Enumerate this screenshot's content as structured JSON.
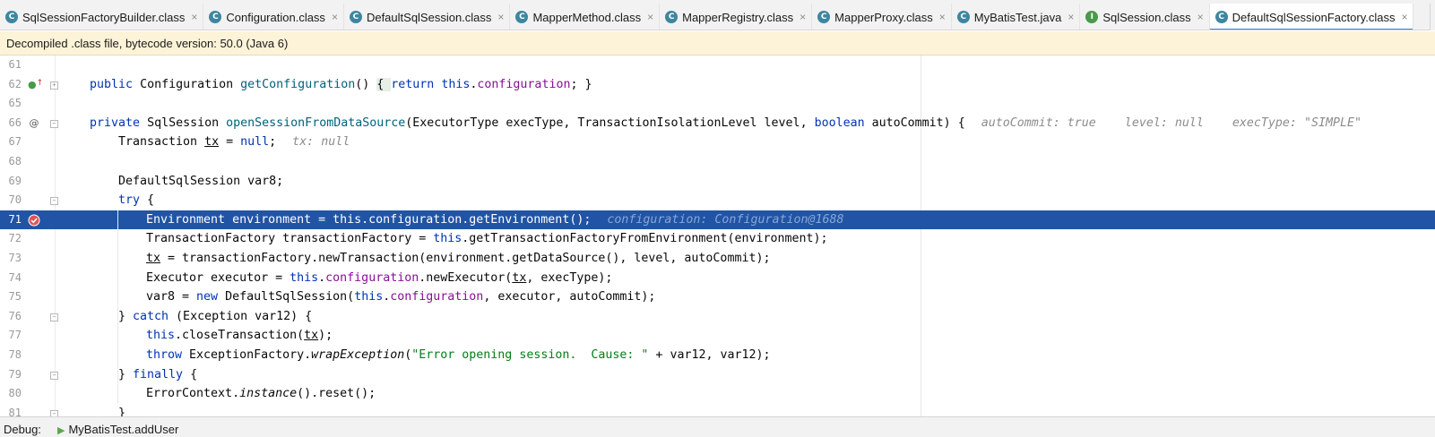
{
  "tabs": [
    {
      "label": "SqlSessionFactoryBuilder.class",
      "icon": "c-class-icon",
      "active": false
    },
    {
      "label": "Configuration.class",
      "icon": "c-class-icon",
      "active": false
    },
    {
      "label": "DefaultSqlSession.class",
      "icon": "c-class-icon",
      "active": false
    },
    {
      "label": "MapperMethod.class",
      "icon": "c-class-icon",
      "active": false
    },
    {
      "label": "MapperRegistry.class",
      "icon": "c-class-icon",
      "active": false
    },
    {
      "label": "MapperProxy.class",
      "icon": "c-class-icon",
      "active": false
    },
    {
      "label": "MyBatisTest.java",
      "icon": "java-class-icon",
      "active": false
    },
    {
      "label": "SqlSession.class",
      "icon": "interface-icon",
      "active": false
    },
    {
      "label": "DefaultSqlSessionFactory.class",
      "icon": "c-class-icon",
      "active": true
    }
  ],
  "tab_close_glyph": "×",
  "infobar": {
    "text": "Decompiled .class file, bytecode version: 50.0 (Java 6)"
  },
  "editor": {
    "highlight_color": "#2154a5",
    "lines": [
      {
        "n": "61"
      },
      {
        "n": "62"
      },
      {
        "n": "65"
      },
      {
        "n": "66"
      },
      {
        "n": "67"
      },
      {
        "n": "68"
      },
      {
        "n": "69"
      },
      {
        "n": "70"
      },
      {
        "n": "71"
      },
      {
        "n": "72"
      },
      {
        "n": "73"
      },
      {
        "n": "74"
      },
      {
        "n": "75"
      },
      {
        "n": "76"
      },
      {
        "n": "77"
      },
      {
        "n": "78"
      },
      {
        "n": "79"
      },
      {
        "n": "80"
      },
      {
        "n": "81"
      }
    ],
    "tokens": {
      "public": "public",
      "private": "private",
      "return": "return",
      "this": "this",
      "null": "null",
      "boolean": "boolean",
      "try": "try",
      "catch": "catch",
      "finally": "finally",
      "new": "new",
      "throw": "throw",
      "configuration": "configuration",
      "getConfiguration": "getConfiguration",
      "openSessionFromDataSource": "openSessionFromDataSource",
      "tx": "tx",
      "wrapException": "wrapException",
      "instance": "instance",
      "error_string": "\"Error opening session.  Cause: \""
    },
    "texts": {
      "l62a": "Configuration ",
      "l62b": "() ",
      "l62c": "{ ",
      "l62d": ".",
      "l62e": "; }",
      "l66a": "SqlSession ",
      "l66b": "(ExecutorType execType, TransactionIsolationLevel level, ",
      "l66c": " autoCommit) {",
      "l67a": "Transaction ",
      "l67b": " = ",
      "l67c": ";",
      "l69": "DefaultSqlSession var8;",
      "l70": " {",
      "l71": "Environment environment = this.configuration.getEnvironment();",
      "l72a": "TransactionFactory transactionFactory = ",
      "l72b": ".getTransactionFactoryFromEnvironment(environment);",
      "l73a": " = transactionFactory.newTransaction(environment.getDataSource(), level, autoCommit);",
      "l74a": "Executor executor = ",
      "l74b": ".",
      "l74c": ".newExecutor(",
      "l74d": ", execType);",
      "l75a": "var8 = ",
      "l75b": " DefaultSqlSession(",
      "l75c": ".",
      "l75d": ", executor, autoCommit);",
      "l76a": "} ",
      "l76b": " (Exception var12) {",
      "l77a": ".closeTransaction(",
      "l77b": ");",
      "l78a": " ExceptionFactory.",
      "l78b": "(",
      "l78c": " + var12, var12);",
      "l79a": "} ",
      "l79b": " {",
      "l80a": "ErrorContext.",
      "l80b": "().reset();",
      "l81": "}"
    },
    "hints": {
      "l66": "autoCommit: true    level: null    execType: \"SIMPLE\"",
      "l67": "tx: null",
      "l71": "configuration: Configuration@1688"
    },
    "gutter_icons": {
      "l62": "override-icon",
      "l66": "annotation-icon",
      "l71": "breakpoint-icon"
    }
  },
  "debug": {
    "label": "Debug:",
    "session": "MyBatisTest.addUser"
  }
}
